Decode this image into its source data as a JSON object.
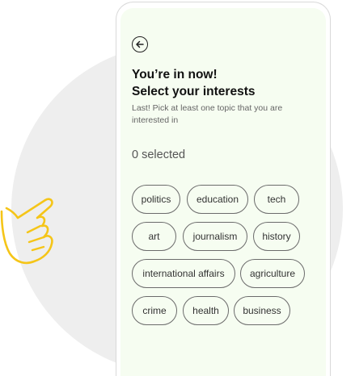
{
  "header": {
    "back_icon": "arrow-left-icon",
    "title_line1": "You’re in now!",
    "title_line2": "Select your interests",
    "subtitle": "Last! Pick at least one topic that you are interested in"
  },
  "selection": {
    "count_text": "0 selected"
  },
  "topics": [
    "politics",
    "education",
    "tech",
    "art",
    "journalism",
    "history",
    "international affairs",
    "agriculture",
    "crime",
    "health",
    "business"
  ],
  "decor": {
    "hand_icon": "pointing-hand-icon",
    "hand_color": "#f5c518",
    "circle_color": "#eeeeee",
    "screen_color": "#f6fdf1"
  }
}
